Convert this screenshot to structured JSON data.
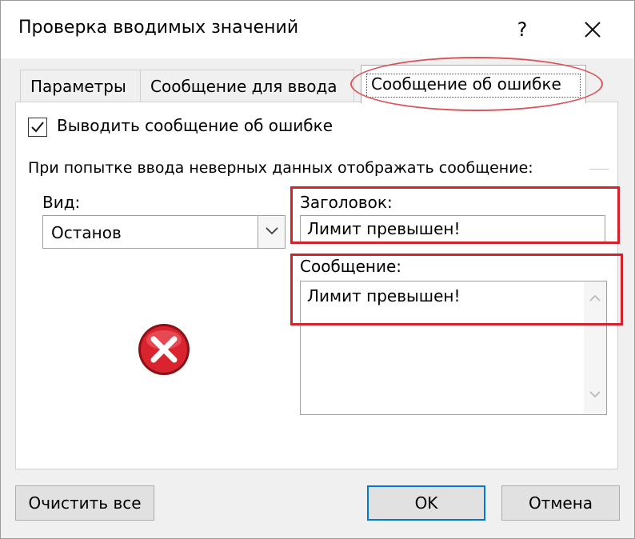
{
  "window": {
    "title": "Проверка вводимых значений",
    "help_label": "?"
  },
  "tabs": [
    {
      "label": "Параметры"
    },
    {
      "label": "Сообщение для ввода"
    },
    {
      "label": "Сообщение об ошибке",
      "selected": true
    }
  ],
  "error_tab": {
    "show_error_checkbox": {
      "label": "Выводить сообщение об ошибке",
      "checked": true
    },
    "group_label": "При попытке ввода неверных данных отображать сообщение:",
    "type": {
      "label": "Вид:",
      "value": "Останов",
      "icon": "stop-error-icon"
    },
    "title": {
      "label": "Заголовок:",
      "value": "Лимит превышен!"
    },
    "message": {
      "label": "Сообщение:",
      "value": "Лимит превышен!"
    }
  },
  "buttons": {
    "clear_all": "Очистить все",
    "ok": "OK",
    "cancel": "Отмена"
  },
  "colors": {
    "annotation_red": "#d0232c",
    "annotation_ellipse": "#d9565c",
    "default_button_border": "#0078d7",
    "stop_icon_red": "#d9232e"
  }
}
